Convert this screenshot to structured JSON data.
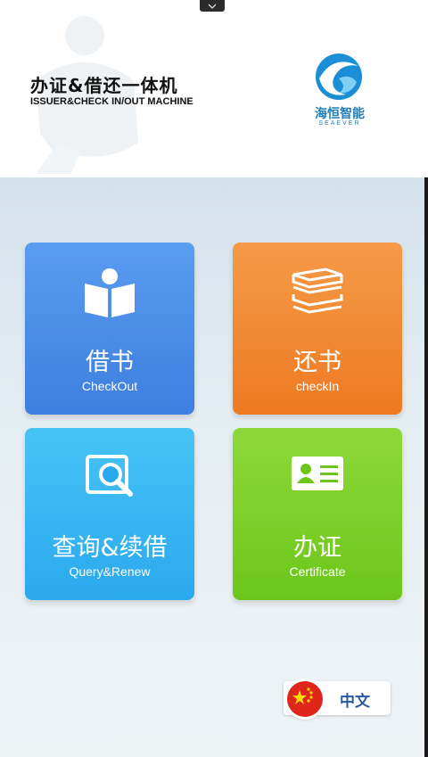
{
  "header": {
    "title_cn": "办证&借还一体机",
    "title_en": "ISSUER&CHECK IN/OUT MACHINE",
    "logo_cn": "海恒智能",
    "logo_en": "SEAEVER",
    "handle_icon": "chevron-down-icon"
  },
  "tiles": [
    {
      "cn": "借书",
      "en": "CheckOut",
      "icon": "open-book-icon",
      "color": "#4a8ce8"
    },
    {
      "cn": "还书",
      "en": "checkIn",
      "icon": "book-stack-icon",
      "color": "#f08a34"
    },
    {
      "cn": "查询&续借",
      "en": "Query&Renew",
      "icon": "search-book-icon",
      "color": "#36b6f2"
    },
    {
      "cn": "办证",
      "en": "Certificate",
      "icon": "id-card-icon",
      "color": "#7ccf28"
    }
  ],
  "language": {
    "label": "中文",
    "flag_icon": "china-flag-icon"
  }
}
